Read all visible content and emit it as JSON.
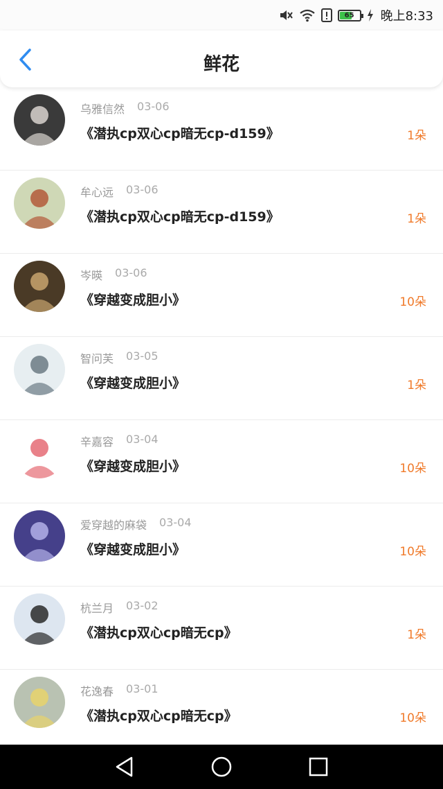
{
  "status_bar": {
    "battery": "65",
    "battery_level": 0.65,
    "time": "晚上8:33"
  },
  "header": {
    "title": "鲜花"
  },
  "list": [
    {
      "user": "乌雅信然",
      "date": "03-06",
      "book": "《潜执cp双心cp暗无cp-d159》",
      "count": "1朵",
      "avatar_colors": [
        "#3a3a3a",
        "#d9d4cf"
      ]
    },
    {
      "user": "牟心远",
      "date": "03-06",
      "book": "《潜执cp双心cp暗无cp-d159》",
      "count": "1朵",
      "avatar_colors": [
        "#cfd8b6",
        "#b35a3a"
      ]
    },
    {
      "user": "岑暎",
      "date": "03-06",
      "book": "《穿越变成胆小》",
      "count": "10朵",
      "avatar_colors": [
        "#4a3a26",
        "#c8a56f"
      ]
    },
    {
      "user": "智问芙",
      "date": "03-05",
      "book": "《穿越变成胆小》",
      "count": "1朵",
      "avatar_colors": [
        "#e7eef1",
        "#6b7a84"
      ]
    },
    {
      "user": "辛嘉容",
      "date": "03-04",
      "book": "《穿越变成胆小》",
      "count": "10朵",
      "avatar_colors": [
        "#ffffff",
        "#e56b74"
      ]
    },
    {
      "user": "爱穿越的麻袋",
      "date": "03-04",
      "book": "《穿越变成胆小》",
      "count": "10朵",
      "avatar_colors": [
        "#45408a",
        "#b3b0e8"
      ]
    },
    {
      "user": "杭兰月",
      "date": "03-02",
      "book": "《潜执cp双心cp暗无cp》",
      "count": "1朵",
      "avatar_colors": [
        "#dde6f0",
        "#2a2a2a"
      ]
    },
    {
      "user": "花逸春",
      "date": "03-01",
      "book": "《潜执cp双心cp暗无cp》",
      "count": "10朵",
      "avatar_colors": [
        "#b9c2b2",
        "#e8d36b"
      ]
    }
  ],
  "colors": {
    "accent": "#2f8cf0",
    "count": "#f07a2a"
  },
  "nav": {
    "back": "back-icon",
    "home": "home-icon",
    "recents": "recents-icon"
  }
}
